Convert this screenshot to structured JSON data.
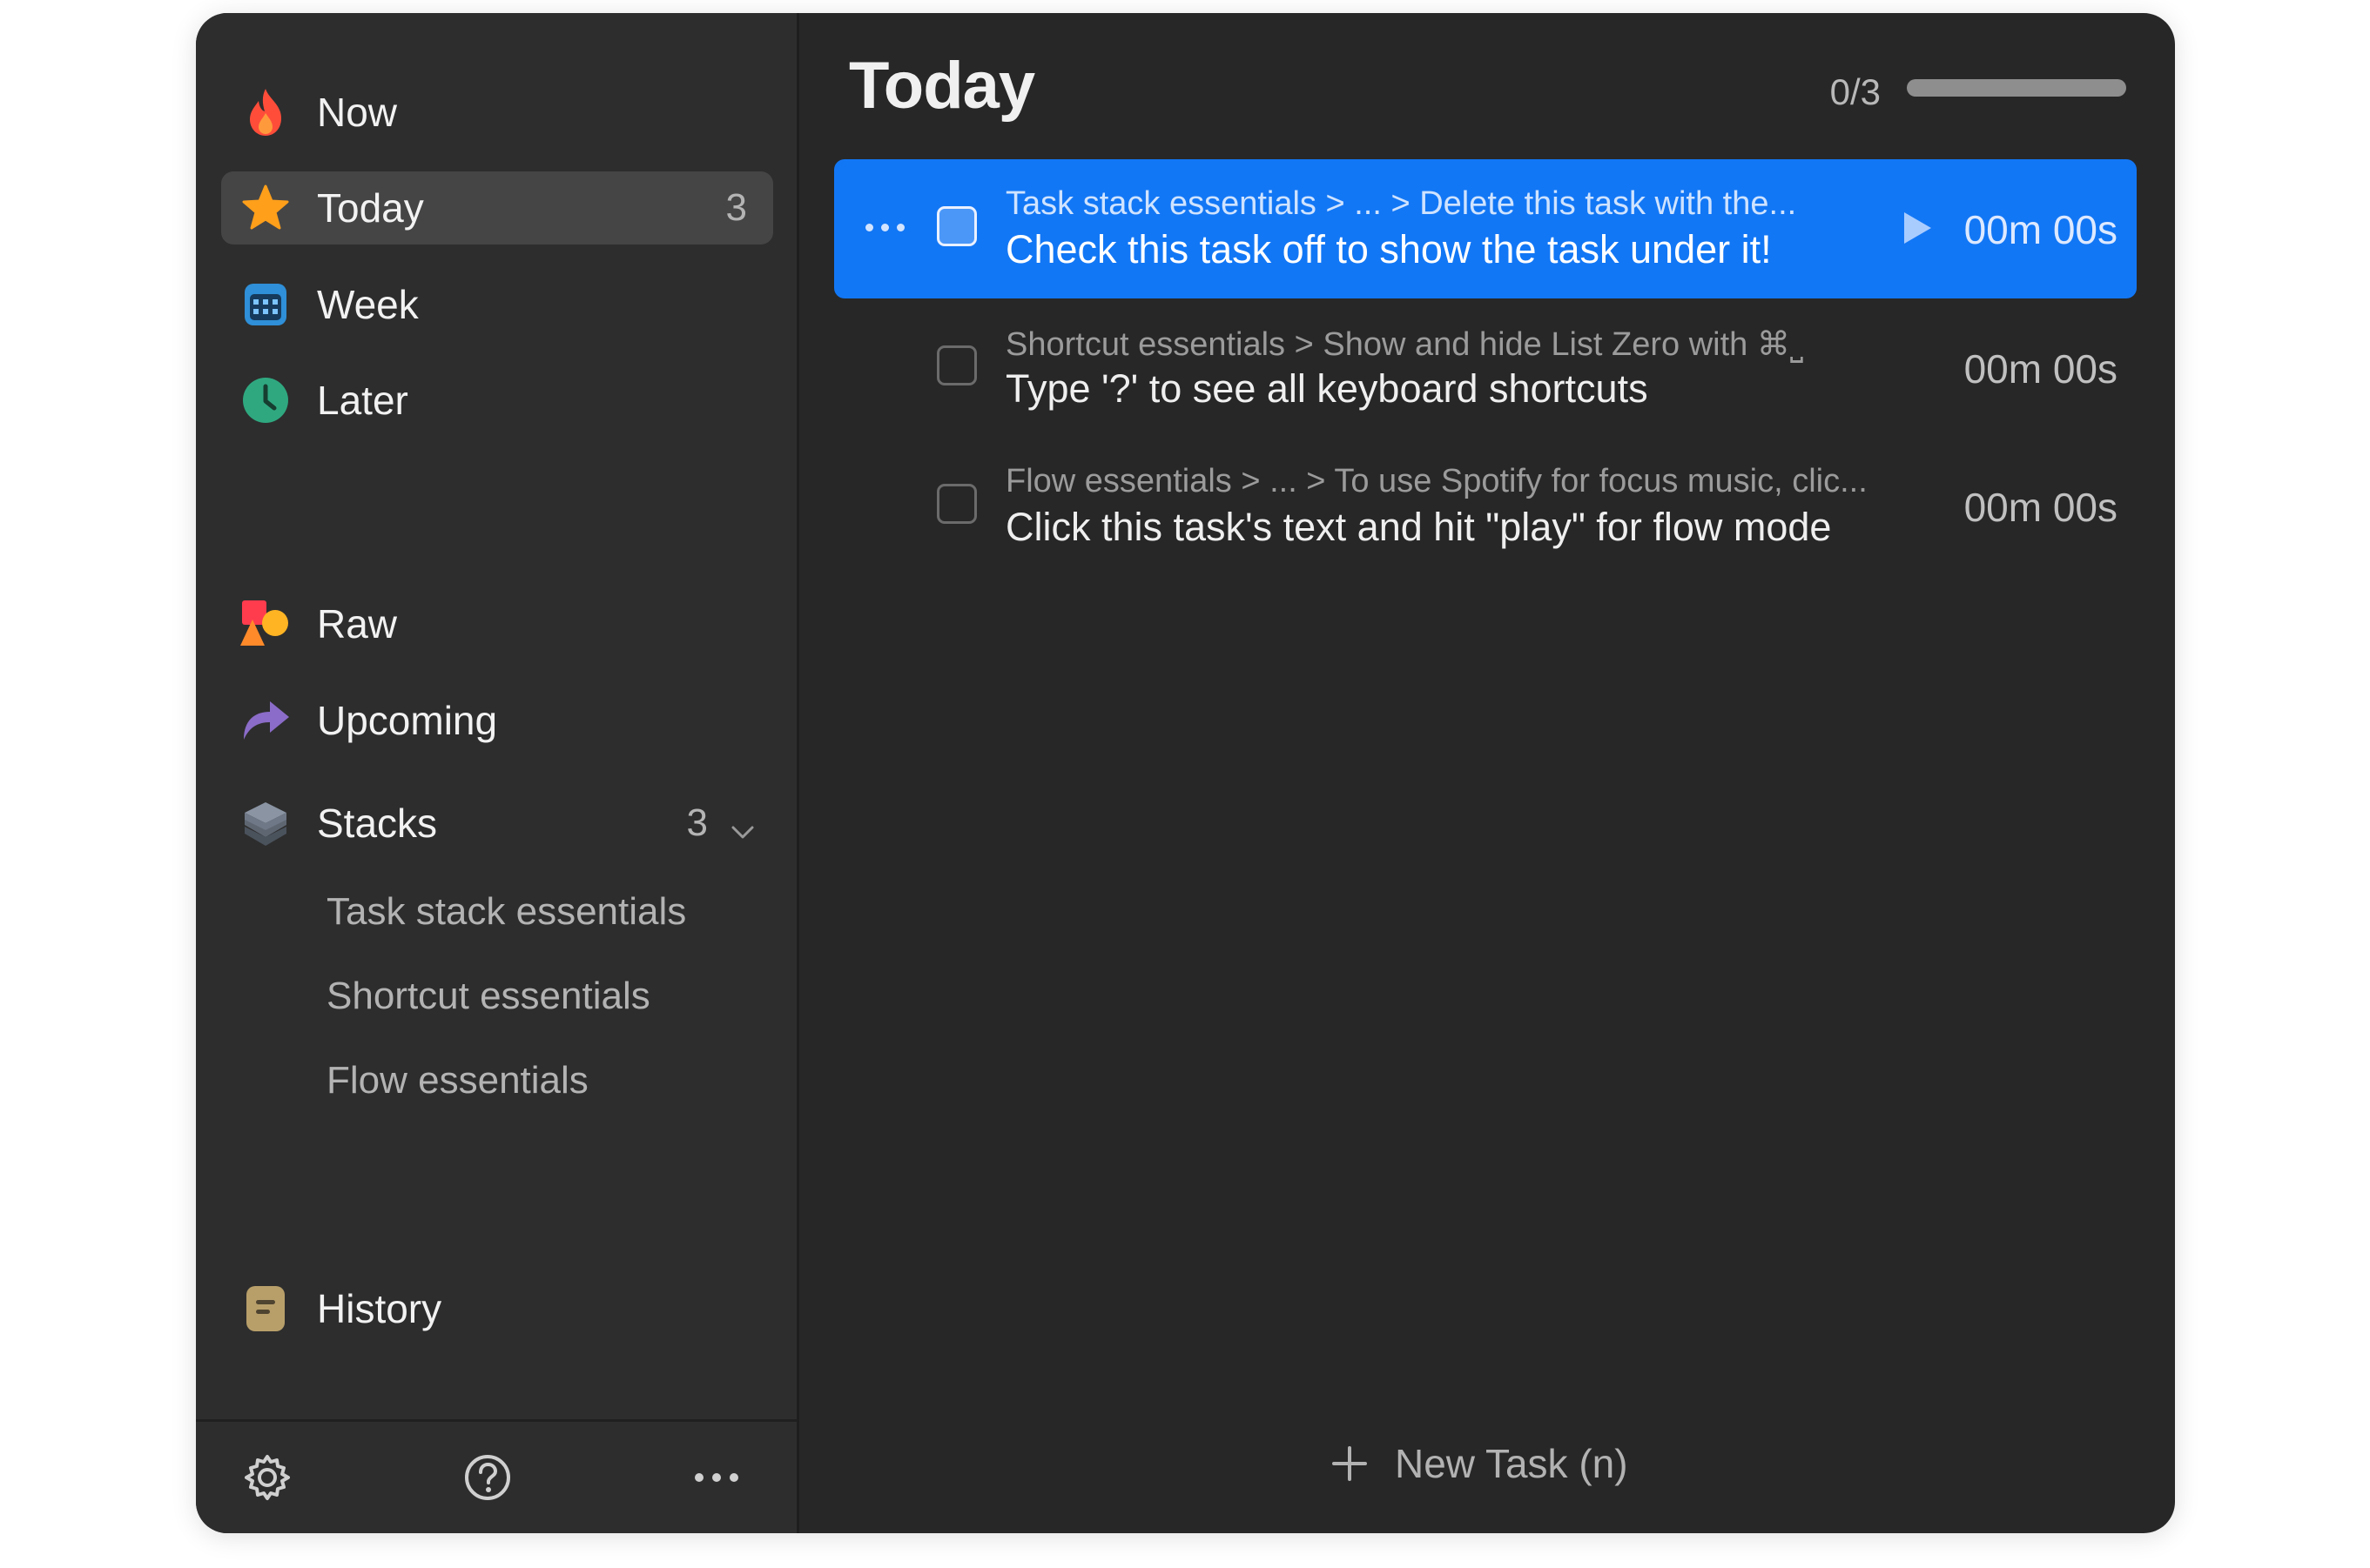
{
  "sidebar": {
    "primary": [
      {
        "label": "Now",
        "icon": "flame-icon",
        "color": "#ff4d3a"
      },
      {
        "label": "Today",
        "icon": "star-icon",
        "color": "#ff9f1a",
        "count": "3",
        "active": true
      },
      {
        "label": "Week",
        "icon": "calendar-icon",
        "color": "#2f8fd8"
      },
      {
        "label": "Later",
        "icon": "clock-icon",
        "color": "#2fa880"
      }
    ],
    "secondary": [
      {
        "label": "Raw",
        "icon": "shapes-icon"
      },
      {
        "label": "Upcoming",
        "icon": "forward-arrow-icon",
        "color": "#8b6cc8"
      }
    ],
    "stacks": {
      "label": "Stacks",
      "icon": "layers-icon",
      "count": "3",
      "expanded": true,
      "items": [
        "Task stack essentials",
        "Shortcut essentials",
        "Flow essentials"
      ]
    },
    "history": {
      "label": "History",
      "icon": "journal-icon",
      "color": "#b89f6a"
    },
    "footer": {
      "settings_icon": "gear-icon",
      "help_icon": "question-icon",
      "more_icon": "more-icon"
    }
  },
  "main": {
    "title": "Today",
    "progress": {
      "label": "0/3",
      "fraction": 0
    },
    "tasks": [
      {
        "path": "Task stack essentials > ... > Delete this task with the...",
        "title": "Check this task off to show the task under it!",
        "time": "00m 00s",
        "selected": true,
        "checked": false
      },
      {
        "path": "Shortcut essentials > Show and hide List Zero with ⌘⎵",
        "title": "Type '?' to see all keyboard shortcuts",
        "time": "00m 00s",
        "selected": false,
        "checked": false
      },
      {
        "path": "Flow essentials > ... > To use Spotify for focus music, clic...",
        "title": "Click this task's text and hit \"play\" for flow mode",
        "time": "00m 00s",
        "selected": false,
        "checked": false
      }
    ],
    "new_task": "New Task (n)"
  }
}
